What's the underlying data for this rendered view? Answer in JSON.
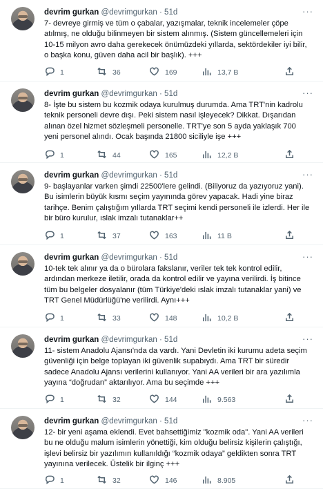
{
  "author": {
    "name": "devrim gurkan",
    "handle": "@devrimgurkan",
    "separator": "·"
  },
  "tweets": [
    {
      "time": "51d",
      "text": "7- devreye girmiş ve tüm o çabalar, yazışmalar, teknik incelemeler çöpe atılmış, ne olduğu bilinmeyen bir sistem alınmış. (Sistem güncellemeleri için 10-15 milyon avro daha gerekecek önümüzdeki yıllarda, sektördekiler iyi bilir, o başka konu, güven daha acil bir başlık). +++",
      "replies": "1",
      "retweets": "36",
      "likes": "169",
      "views": "13,7 B"
    },
    {
      "time": "51d",
      "text": "8- İşte bu sistem bu kozmik odaya kurulmuş durumda. Ama TRT'nin kadrolu teknik personeli devre dışı. Peki sistem nasıl işleyecek? Dikkat. Dışarıdan alınan özel hizmet sözleşmeli personelle. TRT'ye son 5 ayda yaklaşık 700 yeni personel alındı. Ocak başında 21800 siciliyle işe +++",
      "replies": "1",
      "retweets": "44",
      "likes": "165",
      "views": "12,2 B"
    },
    {
      "time": "51d",
      "text": "9- başlayanlar varken şimdi 22500'lere gelindi. (Biliyoruz da yazıyoruz yani). Bu isimlerin büyük kısmı seçim yayınında görev yapacak. Hadi yine biraz tarihçe. Benim çalıştığım yıllarda TRT seçimi kendi personeli ile izlerdi. Her ile bir büro kurulur, ıslak imzalı tutanaklar++",
      "replies": "1",
      "retweets": "37",
      "likes": "163",
      "views": "11 B"
    },
    {
      "time": "51d",
      "text": "10-tek tek alınır ya da o bürolara fakslanır, veriler tek tek kontrol edilir, ardından merkeze iletilir, orada da kontrol edilir ve yayına verilirdi. İş bitince tüm bu belgeler dosyalanır (tüm Türkiye'deki ıslak imzalı tutanaklar yani) ve TRT Genel Müdürlüğü'ne verilirdi. Aynı+++",
      "replies": "1",
      "retweets": "33",
      "likes": "148",
      "views": "10,2 B"
    },
    {
      "time": "51d",
      "text": "11- sistem Anadolu Ajansı'nda da vardı. Yani Devletin iki kurumu adeta seçim güvenliği için belge toplayan iki güvenlik supabıydı. Ama TRT bir süredir sadece Anadolu Ajansı verilerini kullanıyor. Yani AA verileri bir ara yazılımla yayına “doğrudan” aktarılıyor. Ama bu seçimde +++",
      "replies": "1",
      "retweets": "32",
      "likes": "144",
      "views": "9.563"
    },
    {
      "time": "51d",
      "text": "12- bir yeni aşama eklendi. Evet bahsettiğimiz \"kozmik oda\". Yani AA verileri bu ne olduğu malum isimlerin yönettiği, kim olduğu belirsiz kişilerin çalıştığı, işlevi belirsiz bir yazılımın kullanıldığı “kozmik odaya” geldikten sonra TRT yayınına verilecek. Üstelik bir ilginç +++",
      "replies": "1",
      "retweets": "32",
      "likes": "146",
      "views": "8.905"
    }
  ]
}
